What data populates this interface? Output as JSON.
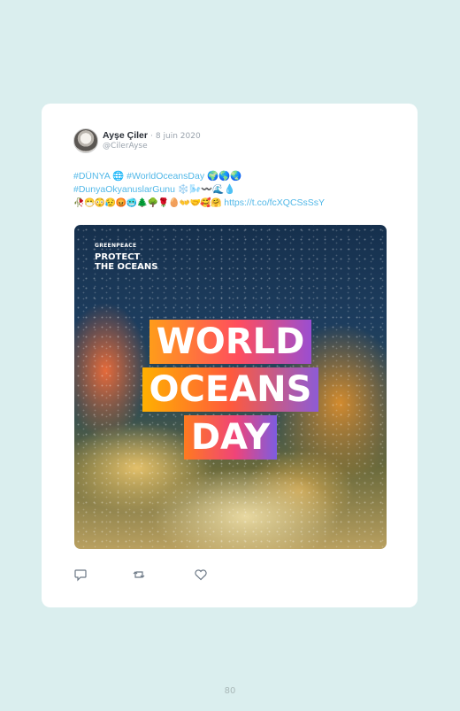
{
  "tweet": {
    "author_name": "Ayşe Çiler",
    "separator": "·",
    "date": "8 juin 2020",
    "handle": "@CilerAyse",
    "text_line1": "#DÜNYA 🌐 #WorldOceansDay 🌍🌎🌏",
    "text_line2": "#DunyaOkyanuslarGunu ❄️🌬️〰️🌊💧",
    "text_line3_emojis": "🥀😷😳😥😡🥶🌲🌳🌹🥚👐🤝🥰🤗",
    "link": "https://t.co/fcXQCSsSsY"
  },
  "media": {
    "org": "GREENPEACE",
    "tagline_line1": "PROTECT",
    "tagline_line2": "THE OCEANS",
    "headline_line1": "WORLD",
    "headline_line2": "OCEANS",
    "headline_line3": "DAY"
  },
  "actions": {
    "reply_icon": "reply-icon",
    "retweet_icon": "retweet-icon",
    "like_icon": "heart-icon"
  },
  "page": {
    "number": "80"
  }
}
